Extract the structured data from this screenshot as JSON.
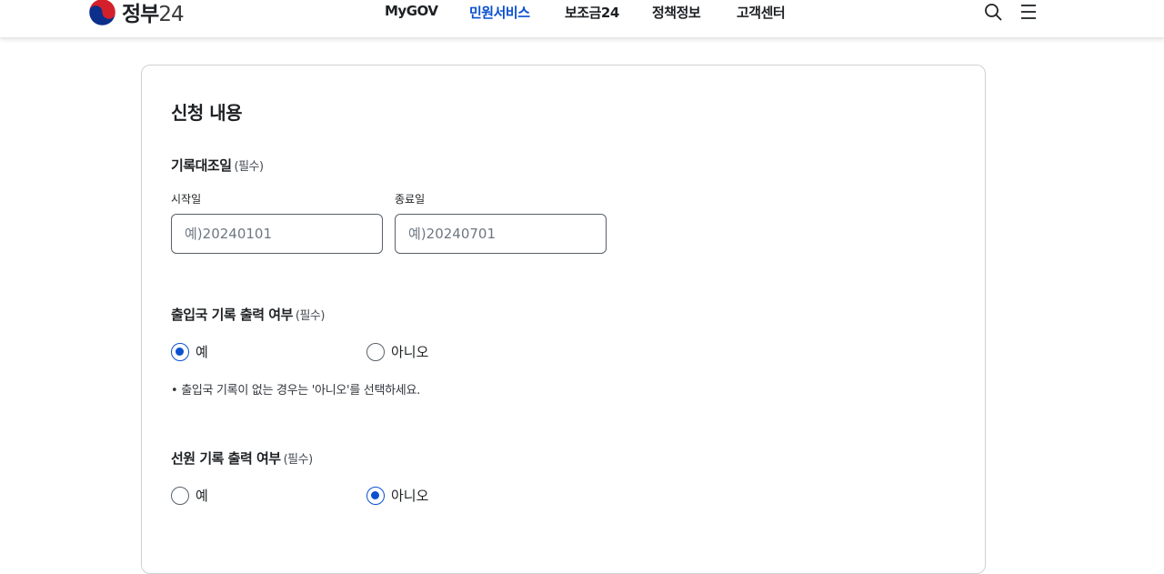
{
  "header": {
    "logo_text": "정부",
    "logo_num": "24",
    "nav": [
      "MyGOV",
      "민원서비스",
      "보조금24",
      "정책정보",
      "고객센터"
    ],
    "active_nav": "민원서비스",
    "icons": [
      "search-icon",
      "hamburger-menu-icon"
    ],
    "accent_color": "#0b50d0"
  },
  "form": {
    "section_title": "신청 내용",
    "record_period": {
      "title": "기록대조일",
      "required_mark": "(필수)",
      "start_label": "시작일",
      "start_placeholder": "예)20240101",
      "end_label": "종료일",
      "end_placeholder": "예)20240701"
    },
    "immigration_record": {
      "title": "출입국 기록 출력 여부",
      "required_mark": "(필수)",
      "options": [
        "예",
        "아니오"
      ],
      "selected": "예",
      "note": "• 출입국 기록이 없는 경우는 '아니오'를 선택하세요."
    },
    "seaman_record": {
      "title": "선원 기록 출력 여부",
      "required_mark": "(필수)",
      "options": [
        "예",
        "아니오"
      ],
      "selected": "아니오"
    }
  }
}
